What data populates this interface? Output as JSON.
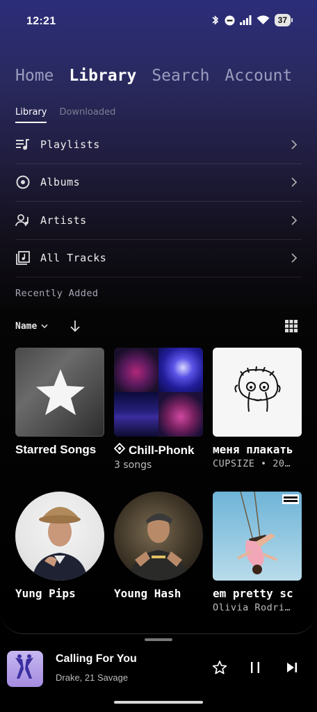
{
  "status_bar": {
    "time": "12:21",
    "battery": "37",
    "icons": [
      "bluetooth-icon",
      "do-not-disturb-icon",
      "signal-icon",
      "wifi-icon",
      "battery-icon"
    ]
  },
  "main_tabs": [
    {
      "label": "Home",
      "active": false
    },
    {
      "label": "Library",
      "active": true
    },
    {
      "label": "Search",
      "active": false
    },
    {
      "label": "Account",
      "active": false
    }
  ],
  "sub_tabs": [
    {
      "label": "Library",
      "active": true
    },
    {
      "label": "Downloaded",
      "active": false
    }
  ],
  "library_items": [
    {
      "label": "Playlists",
      "icon": "playlist-icon"
    },
    {
      "label": "Albums",
      "icon": "album-icon"
    },
    {
      "label": "Artists",
      "icon": "artist-icon"
    },
    {
      "label": "All Tracks",
      "icon": "tracks-icon"
    }
  ],
  "recent_heading": "Recently Added",
  "sort": {
    "label": "Name",
    "direction": "descending"
  },
  "cards": [
    {
      "title": "Starred Songs",
      "subtitle": "",
      "type": "playlist"
    },
    {
      "title": "Chill-Phonk",
      "subtitle": "3 songs",
      "type": "playlist"
    },
    {
      "title": "меня плакать",
      "subtitle": "CUPSIZE • 20…",
      "type": "album"
    },
    {
      "title": "Yung Pips",
      "subtitle": "",
      "type": "artist"
    },
    {
      "title": "Young Hash",
      "subtitle": "",
      "type": "artist"
    },
    {
      "title": "em pretty sc",
      "subtitle": "Olivia Rodri…",
      "type": "album"
    }
  ],
  "now_playing": {
    "title": "Calling For You",
    "artist": "Drake, 21 Savage"
  },
  "colors": {
    "background": "#000000",
    "gradient_top": "#2c2d7a",
    "text_primary": "#ffffff",
    "text_secondary": "#bdbdbd",
    "tab_inactive": "#9a9dbf"
  }
}
